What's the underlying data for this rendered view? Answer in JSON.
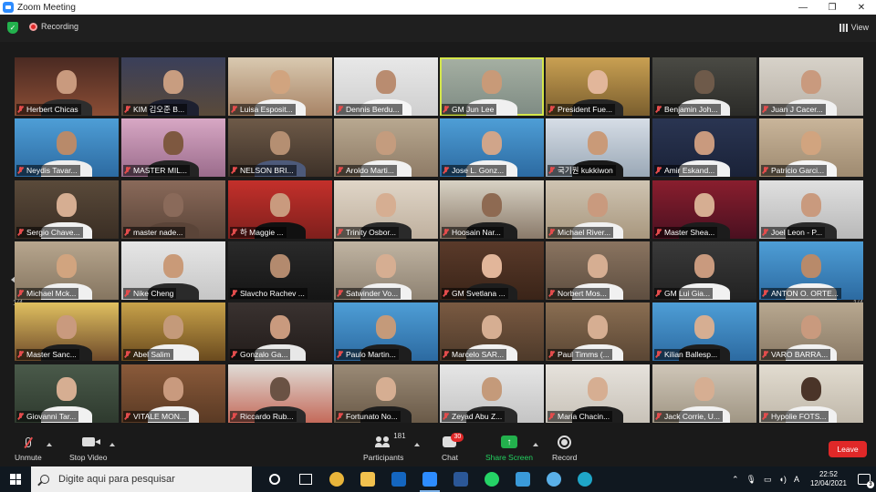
{
  "window": {
    "title": "Zoom Meeting",
    "controls": {
      "minimize": "—",
      "maximize": "❐",
      "close": "✕"
    }
  },
  "topbar": {
    "recording_label": "Recording",
    "view_label": "View"
  },
  "gallery": {
    "page_left": "1/4",
    "page_right": "1/4",
    "tiles": [
      {
        "name": "Herbert Chicas",
        "c1": "#4a2a22",
        "c2": "#8a4d35",
        "skin": "#c99a7e",
        "cloth": "#2d2d2d"
      },
      {
        "name": "KIM 김오준 B...",
        "c1": "#3a3f5a",
        "c2": "#5a4a3a",
        "skin": "#c89d80",
        "cloth": "#1d2030"
      },
      {
        "name": "Luisa Esposit...",
        "c1": "#d9c9b0",
        "c2": "#a88466",
        "skin": "#d1a47f",
        "cloth": "#f2f2f2"
      },
      {
        "name": "Dennis Berdu...",
        "c1": "#e8e8e8",
        "c2": "#cfcfcf",
        "skin": "#b98c70",
        "cloth": "#f5f5f5"
      },
      {
        "name": "GM Jun Lee",
        "c1": "#a6b0a3",
        "c2": "#7e8b83",
        "skin": "#c89a78",
        "cloth": "#f0f0f0",
        "active": true
      },
      {
        "name": "President Fue...",
        "c1": "#c9a052",
        "c2": "#7a5e2e",
        "skin": "#e2b69a",
        "cloth": "#262626"
      },
      {
        "name": "Benjamin Joh...",
        "c1": "#4a4a44",
        "c2": "#2b2b28",
        "skin": "#6e5a4a",
        "cloth": "#eeeeee"
      },
      {
        "name": "Juan J Cacer...",
        "c1": "#d7d2c9",
        "c2": "#b9b2a8",
        "skin": "#c99a7e",
        "cloth": "#f1f1f1"
      },
      {
        "name": "Neydis Tavar...",
        "c1": "#4e9ed6",
        "c2": "#2c6aa1",
        "skin": "#b88a6a",
        "cloth": "#eeeeee"
      },
      {
        "name": "MASTER MIL...",
        "c1": "#d7a7c4",
        "c2": "#9b6c8c",
        "skin": "#7e5840",
        "cloth": "#242424"
      },
      {
        "name": "NELSON BRI...",
        "c1": "#6e5a48",
        "c2": "#3d3128",
        "skin": "#b58f72",
        "cloth": "#4d5a7a"
      },
      {
        "name": "Aroldo Marti...",
        "c1": "#b8a890",
        "c2": "#8e7b66",
        "skin": "#c49c7e",
        "cloth": "#f1f1f1"
      },
      {
        "name": "Jose L. Gonz...",
        "c1": "#4e9ed6",
        "c2": "#2c6aa1",
        "skin": "#d0a58a",
        "cloth": "#f2f2f2"
      },
      {
        "name": "국기원 kukkiwon",
        "c1": "#d6dde6",
        "c2": "#9aa8b6",
        "skin": "#c99a78",
        "cloth": "#1a1a1a"
      },
      {
        "name": "Amir Eskand...",
        "c1": "#2a3552",
        "c2": "#1a2238",
        "skin": "#c99a7e",
        "cloth": "#f1f1f1"
      },
      {
        "name": "Patricio Garci...",
        "c1": "#c9b59a",
        "c2": "#9e8a70",
        "skin": "#d1a47f",
        "cloth": "#f5f5f5"
      },
      {
        "name": "Sergio Chave...",
        "c1": "#5a4a3a",
        "c2": "#3a2e24",
        "skin": "#d6ae92",
        "cloth": "#f1f1f1"
      },
      {
        "name": "master nade...",
        "c1": "#8a6a5a",
        "c2": "#5a4438",
        "skin": "#8a6a5a",
        "cloth": "#5a4438"
      },
      {
        "name": "하 Maggie ...",
        "c1": "#c4302b",
        "c2": "#7e1f1c",
        "skin": "#c99a7e",
        "cloth": "#111111"
      },
      {
        "name": "Trinity Osbor...",
        "c1": "#e0d6c8",
        "c2": "#bfb09e",
        "skin": "#d6ae92",
        "cloth": "#2a2a2a"
      },
      {
        "name": "Hoosain Nar...",
        "c1": "#d8d2c4",
        "c2": "#8a7a6a",
        "skin": "#8e6a52",
        "cloth": "#1e1e1e"
      },
      {
        "name": "Michael River...",
        "c1": "#cfc4b2",
        "c2": "#a8977e",
        "skin": "#c99a7e",
        "cloth": "#f1f1f1"
      },
      {
        "name": "Master Shea...",
        "c1": "#8a1e2e",
        "c2": "#4a1020",
        "skin": "#d6ae92",
        "cloth": "#1c1c1c"
      },
      {
        "name": "Joel Leon - P...",
        "c1": "#e0e0e0",
        "c2": "#b8b8b8",
        "skin": "#c99a7e",
        "cloth": "#2a2a2a"
      },
      {
        "name": "Michael Mck...",
        "c1": "#b7a68e",
        "c2": "#857560",
        "skin": "#d1a47f",
        "cloth": "#f0f0f0"
      },
      {
        "name": "Nike Cheng",
        "c1": "#e6e6e6",
        "c2": "#c6c6c6",
        "skin": "#c99a78",
        "cloth": "#2a2a2a"
      },
      {
        "name": "Slavcho Rachev ...",
        "c1": "#2a2a2a",
        "c2": "#151515",
        "skin": "#b38a6e",
        "cloth": "#1a1a1a"
      },
      {
        "name": "Satwinder Vo...",
        "c1": "#c0b4a2",
        "c2": "#8e8272",
        "skin": "#d6ae92",
        "cloth": "#f1f1f1"
      },
      {
        "name": "GM Svetlana ...",
        "c1": "#5a3a2a",
        "c2": "#3a2418",
        "skin": "#e2b69a",
        "cloth": "#1e1e1e"
      },
      {
        "name": "Norbert Mos...",
        "c1": "#8a7460",
        "c2": "#5e4e40",
        "skin": "#d6ae92",
        "cloth": "#f1f1f1"
      },
      {
        "name": "GM Lui Gia...",
        "c1": "#3a3a3a",
        "c2": "#222222",
        "skin": "#c99a7e",
        "cloth": "#f1f1f1"
      },
      {
        "name": "ANTON O. ORTE...",
        "c1": "#4e9ed6",
        "c2": "#2c6aa1",
        "skin": "#b88a6a",
        "cloth": "#f2f2f2"
      },
      {
        "name": "Master Sanc...",
        "c1": "#e0c060",
        "c2": "#6e4a2a",
        "skin": "#c99a7e",
        "cloth": "#1e1e1e"
      },
      {
        "name": "Abel Salim",
        "c1": "#c8a24a",
        "c2": "#6a4a1e",
        "skin": "#c49a7a",
        "cloth": "#f0f0f0"
      },
      {
        "name": "Gonzalo Ga...",
        "c1": "#3a3230",
        "c2": "#221c1a",
        "skin": "#c99a7e",
        "cloth": "#e8e8e8"
      },
      {
        "name": "Paulo Martin...",
        "c1": "#4e9ed6",
        "c2": "#2c6aa1",
        "skin": "#c49a7a",
        "cloth": "#1e1e1e"
      },
      {
        "name": "Marcelo SAR...",
        "c1": "#7a5a42",
        "c2": "#4e3a2a",
        "skin": "#d6ae92",
        "cloth": "#f1f1f1"
      },
      {
        "name": "Paul Timms (...",
        "c1": "#8a6e52",
        "c2": "#5a4634",
        "skin": "#d6ae92",
        "cloth": "#f1f1f1"
      },
      {
        "name": "Kilian Ballesp...",
        "c1": "#4e9ed6",
        "c2": "#2c6aa1",
        "skin": "#d6ae92",
        "cloth": "#1e1e1e"
      },
      {
        "name": "VARO BARRA...",
        "c1": "#b8a890",
        "c2": "#8a7a66",
        "skin": "#c99a7e",
        "cloth": "#f1f1f1"
      },
      {
        "name": "Giovanni Tar...",
        "c1": "#4a5a4a",
        "c2": "#2e3a2e",
        "skin": "#d6ae92",
        "cloth": "#f1f1f1"
      },
      {
        "name": "VITALE MON...",
        "c1": "#8a5a3a",
        "c2": "#5a3a24",
        "skin": "#c99a7e",
        "cloth": "#f1f1f1"
      },
      {
        "name": "Riccardo Rub...",
        "c1": "#e0dcd6",
        "c2": "#c46a5a",
        "skin": "#6a5244",
        "cloth": "#2a2a2a"
      },
      {
        "name": "Fortunato No...",
        "c1": "#9a8a76",
        "c2": "#6a5a48",
        "skin": "#d6ae92",
        "cloth": "#1e1e1e"
      },
      {
        "name": "Zeyad Abu Z...",
        "c1": "#e6e6e6",
        "c2": "#c4c4c4",
        "skin": "#c49a7a",
        "cloth": "#2a2a2a"
      },
      {
        "name": "Maria Chacin...",
        "c1": "#e6e2dc",
        "c2": "#c8c2b8",
        "skin": "#d6ae92",
        "cloth": "#1e1e1e"
      },
      {
        "name": "Jack Corrie, U...",
        "c1": "#cfc6b8",
        "c2": "#a09684",
        "skin": "#d6ae92",
        "cloth": "#f1f1f1"
      },
      {
        "name": "Hypolie FOTS...",
        "c1": "#e2dcd0",
        "c2": "#c0b8aa",
        "skin": "#4a3428",
        "cloth": "#f1f1f1"
      }
    ]
  },
  "controls": {
    "unmute": "Unmute",
    "stop_video": "Stop Video",
    "participants": "Participants",
    "participants_count": "181",
    "chat": "Chat",
    "chat_badge": "30",
    "share_screen": "Share Screen",
    "record": "Record",
    "leave": "Leave"
  },
  "taskbar": {
    "search_placeholder": "Digite aqui para pesquisar",
    "time": "22:52",
    "date": "12/04/2021",
    "lang": "A",
    "notif_count": "3",
    "apps": [
      {
        "name": "chrome-icon",
        "color": "#e8b43a"
      },
      {
        "name": "file-explorer-icon",
        "color": "#f2c14e"
      },
      {
        "name": "outlook-icon",
        "color": "#1466c0"
      },
      {
        "name": "zoom-icon",
        "color": "#2d8cff",
        "active": true
      },
      {
        "name": "word-icon",
        "color": "#2b5797"
      },
      {
        "name": "whatsapp-icon",
        "color": "#25d366"
      },
      {
        "name": "phone-link-icon",
        "color": "#3a9ad9"
      },
      {
        "name": "misc-app-icon",
        "color": "#5ab0e8"
      },
      {
        "name": "edge-icon",
        "color": "#1fa6c8"
      }
    ]
  }
}
